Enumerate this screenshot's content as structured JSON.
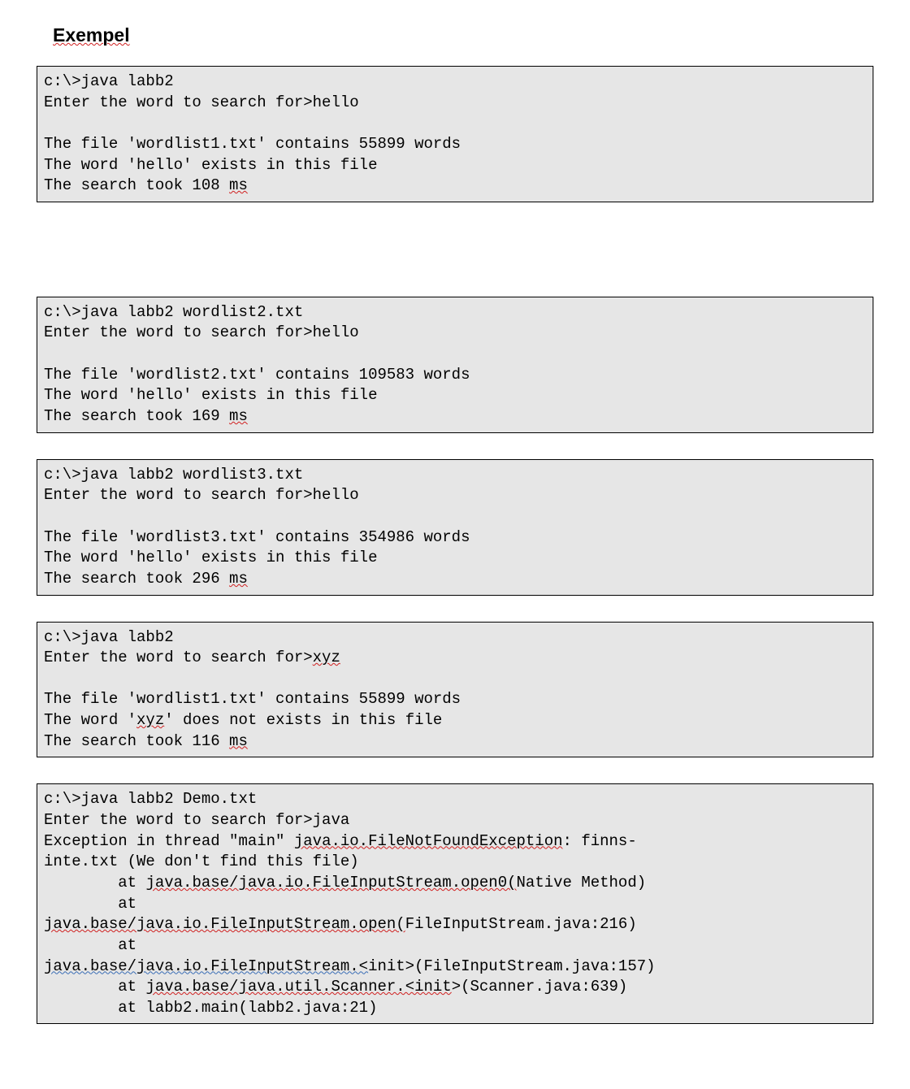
{
  "heading": "Exempel",
  "box1": {
    "l1a": "c:\\>java labb2",
    "l2": "Enter the word to search for>hello",
    "l3": "",
    "l4": "The file 'wordlist1.txt' contains 55899 words",
    "l5": "The word 'hello' exists in this file",
    "l6a": "The search took 108 ",
    "l6b": "ms"
  },
  "box2": {
    "l1": "c:\\>java labb2 wordlist2.txt",
    "l2": "Enter the word to search for>hello",
    "l3": "",
    "l4": "The file 'wordlist2.txt' contains 109583 words",
    "l5": "The word 'hello' exists in this file",
    "l6a": "The search took 169 ",
    "l6b": "ms"
  },
  "box3": {
    "l1": "c:\\>java labb2 wordlist3.txt",
    "l2": "Enter the word to search for>hello",
    "l3": "",
    "l4": "The file 'wordlist3.txt' contains 354986 words",
    "l5": "The word 'hello' exists in this file",
    "l6a": "The search took 296 ",
    "l6b": "ms"
  },
  "box4": {
    "l1": "c:\\>java labb2",
    "l2a": "Enter the word to search for>",
    "l2b": "xyz",
    "l3": "",
    "l4": "The file 'wordlist1.txt' contains 55899 words",
    "l5a": "The word '",
    "l5b": "xyz",
    "l5c": "' does not exists in this file",
    "l6a": "The search took 116 ",
    "l6b": "ms"
  },
  "box5": {
    "l1": "c:\\>java labb2 Demo.txt",
    "l2": "Enter the word to search for>java",
    "l3a": "Exception in thread \"main\" ",
    "l3b": "java.io.FileNotFoundException",
    "l3c": ": finns-",
    "l4": "inte.txt (We don't find this file)",
    "l5a": "        at ",
    "l5b": "java.base/java.io.FileInputStream.open0(",
    "l5c": "Native Method)",
    "l6": "        at",
    "l7a": "java.base/java.io.FileInputStream.open(",
    "l7b": "FileInputStream.java:216)",
    "l8": "        at",
    "l9a": "java.base/java.io.FileInputStream.<",
    "l9b": "init>(FileInputStream.java:157)",
    "l10a": "        at ",
    "l10b": "java.base/java.util.Scanner.<init",
    "l10c": ">(Scanner.java:639)",
    "l11": "        at labb2.main(labb2.java:21)"
  }
}
